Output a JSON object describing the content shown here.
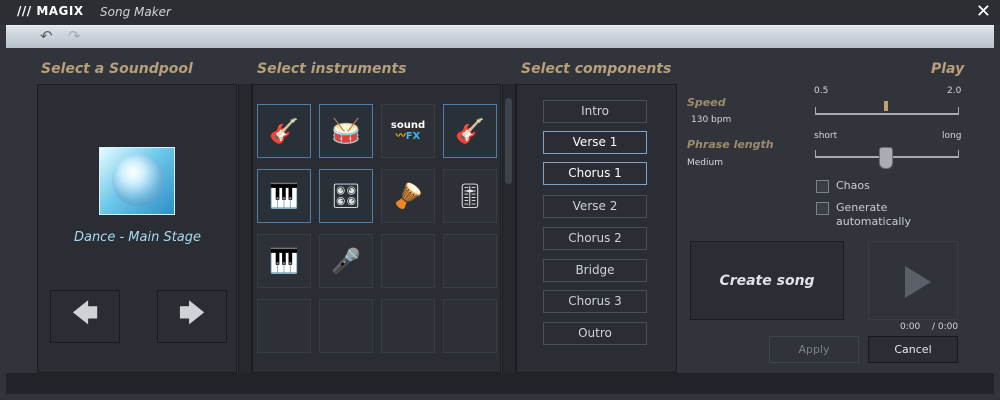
{
  "titlebar": {
    "logo": "/// MAGIX",
    "app_title": "Song Maker",
    "close_icon": "close-icon"
  },
  "toolbar": {
    "undo_icon": "undo-icon",
    "redo_icon": "redo-icon"
  },
  "soundpool": {
    "header": "Select a Soundpool",
    "selected_name": "Dance - Main Stage",
    "image_icon": "disco-ball-icon",
    "prev_icon": "arrow-left-icon",
    "next_icon": "arrow-right-icon"
  },
  "instruments": {
    "header": "Select instruments",
    "items": [
      {
        "icon": "electric-guitar-icon"
      },
      {
        "icon": "drum-kit-icon"
      },
      {
        "icon": "sound-fx-icon",
        "line1": "sound",
        "line2": "FX"
      },
      {
        "icon": "acoustic-guitar-icon"
      },
      {
        "icon": "keyboard-piano-icon"
      },
      {
        "icon": "synthesizer-icon"
      },
      {
        "icon": "congas-icon"
      },
      {
        "icon": "rack-module-icon"
      },
      {
        "icon": "organ-keyboard-icon"
      },
      {
        "icon": "vocalist-icon"
      },
      {
        "icon": ""
      },
      {
        "icon": ""
      },
      {
        "icon": ""
      },
      {
        "icon": ""
      },
      {
        "icon": ""
      },
      {
        "icon": ""
      }
    ]
  },
  "components": {
    "header": "Select components",
    "items": [
      {
        "label": "Intro",
        "selected": false
      },
      {
        "label": "Verse 1",
        "selected": true
      },
      {
        "label": "Chorus 1",
        "selected": true
      },
      {
        "label": "Verse 2",
        "selected": false
      },
      {
        "label": "Chorus 2",
        "selected": false
      },
      {
        "label": "Bridge",
        "selected": false
      },
      {
        "label": "Chorus 3",
        "selected": false
      },
      {
        "label": "Outro",
        "selected": false
      }
    ]
  },
  "play": {
    "header": "Play",
    "speed_label": "Speed",
    "speed_value": "130 bpm",
    "speed_min": "0.5",
    "speed_max": "2.0",
    "phrase_label": "Phrase length",
    "phrase_value": "Medium",
    "phrase_min": "short",
    "phrase_max": "long",
    "chaos_label": "Chaos",
    "generate_label_1": "Generate",
    "generate_label_2": "automatically",
    "create_song": "Create song",
    "time_current": "0:00",
    "time_total": "/ 0:00",
    "apply": "Apply",
    "cancel": "Cancel"
  },
  "colors": {
    "accent": "#b79f79",
    "selected_border": "#7fa5c4",
    "background": "#31353b"
  }
}
